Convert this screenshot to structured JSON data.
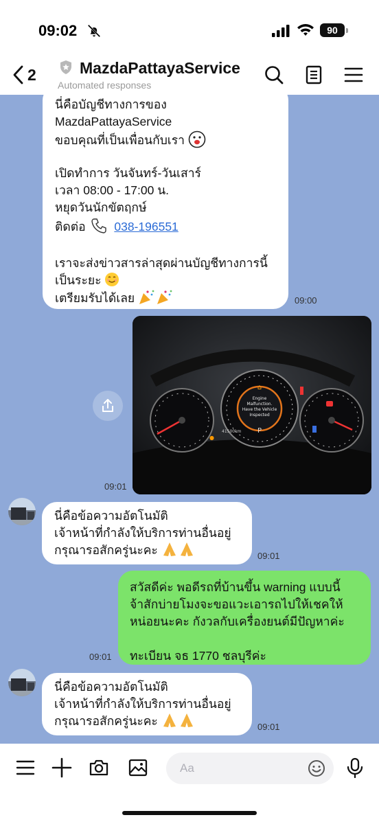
{
  "status_bar": {
    "time": "09:02",
    "battery": "90"
  },
  "header": {
    "back_count": "2",
    "title": "MazdaPattayaService",
    "subtitle": "Automated responses"
  },
  "messages": {
    "welcome": {
      "lines": [
        "นี่คือบัญชีทางการของ",
        "MazdaPattayaService",
        "ขอบคุณที่เป็นเพื่อนกับเรา",
        "",
        "เปิดทำการ วันจันทร์-วันเสาร์",
        "เวลา 08:00 - 17:00 น.",
        "หยุดวันนักขัตฤกษ์",
        "ติดต่อ",
        "",
        "เราจะส่งข่าวสารล่าสุดผ่านบัญชีทางการนี้",
        "เป็นระยะ",
        "เตรียมรับได้เลย"
      ],
      "phone": "038-196551",
      "time": "09:00"
    },
    "photo": {
      "time": "09:01",
      "dash_text_1": "Engine",
      "dash_text_2": "Malfunction.",
      "dash_text_3": "Have the Vehicle",
      "dash_text_4": "Inspected",
      "gear": "P",
      "odo": "41500km"
    },
    "auto_reply_1": {
      "lines": [
        "นี่คือข้อความอัตโนมัติ",
        "เจ้าหน้าที่กำลังให้บริการท่านอื่นอยู่",
        "กรุณารอสักครู่นะคะ"
      ],
      "time": "09:01"
    },
    "user_message": {
      "lines": [
        "สวัสดีค่ะ พอดีรถที่บ้านขึ้น warning แบบนี้",
        "จ้าสักบ่ายโมงจะขอแวะเอารถไปให้เชคให้",
        "หน่อยนะคะ กังวลกับเครื่องยนต์มีปัญหาค่ะ",
        "",
        "ทะเบียน จธ 1770 ชลบุรีค่ะ"
      ],
      "time": "09:01"
    },
    "auto_reply_2": {
      "lines": [
        "นี่คือข้อความอัตโนมัติ",
        "เจ้าหน้าที่กำลังให้บริการท่านอื่นอยู่",
        "กรุณารอสักครู่นะคะ"
      ],
      "time": "09:01"
    }
  },
  "composer": {
    "placeholder": "Aa"
  },
  "colors": {
    "chat_bg": "#8fa9d8",
    "outgoing_bubble": "#7ce36a",
    "incoming_bubble": "#ffffff",
    "link": "#2b6bd6"
  },
  "icons": [
    "bell-off-icon",
    "signal-icon",
    "wifi-icon",
    "battery-icon",
    "back-icon",
    "shield-icon",
    "search-icon",
    "notes-icon",
    "menu-icon",
    "share-icon",
    "keypad-menu-icon",
    "plus-icon",
    "camera-icon",
    "image-icon",
    "emoji-icon",
    "mic-icon"
  ]
}
